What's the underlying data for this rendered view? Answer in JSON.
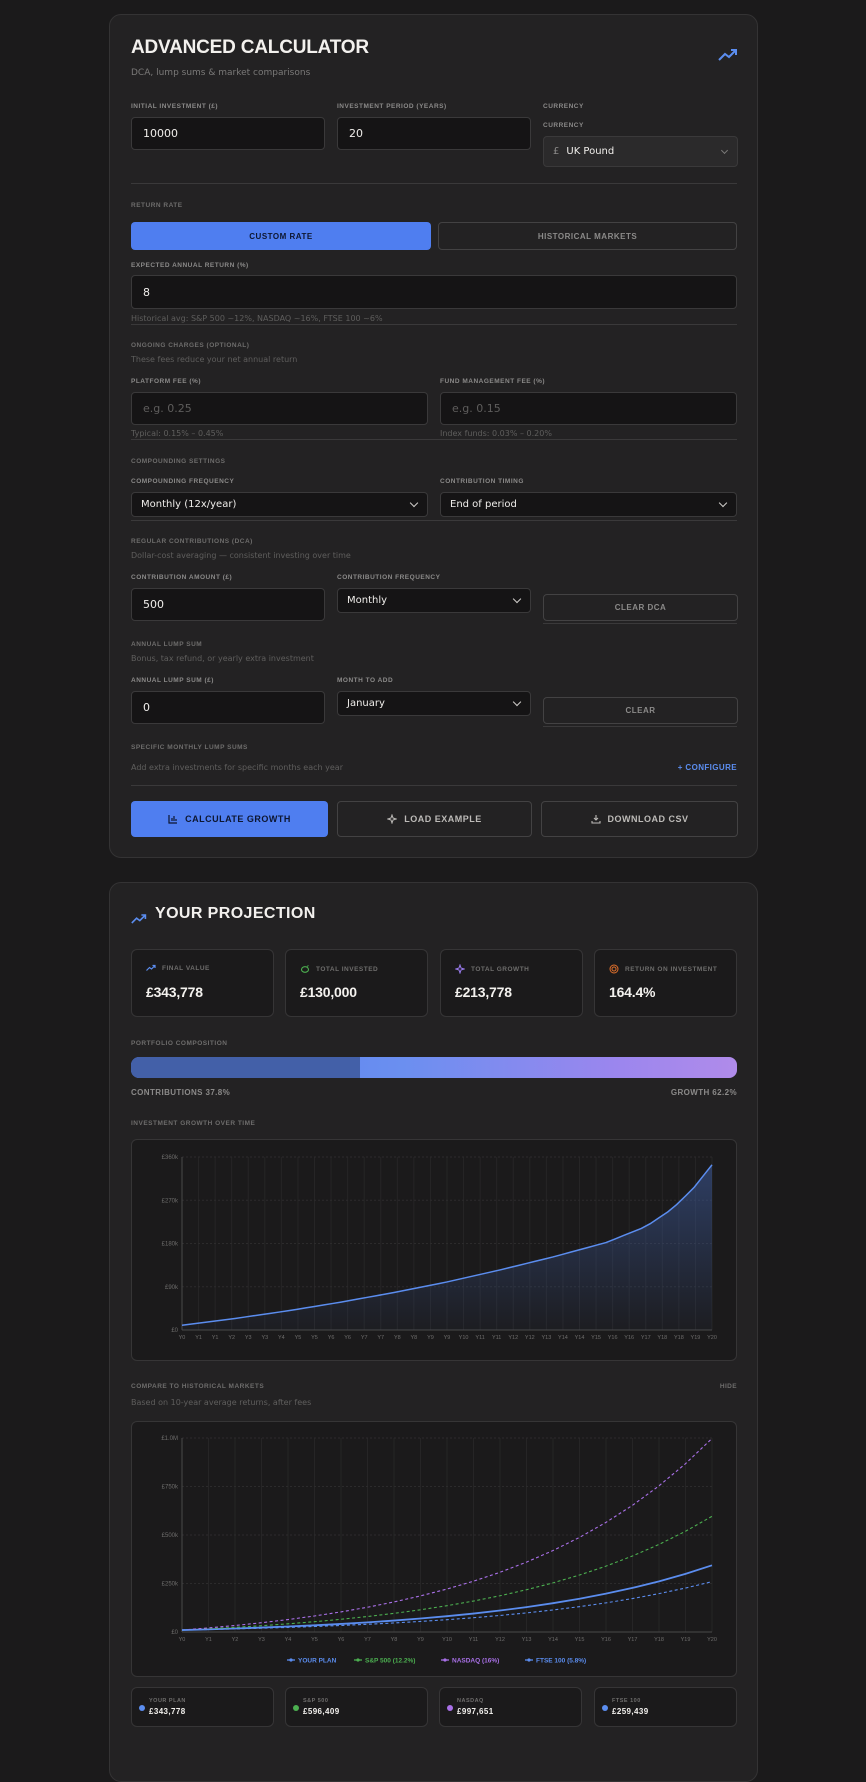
{
  "calc": {
    "title": "ADVANCED CALCULATOR",
    "subtitle": "DCA, lump sums & market comparisons",
    "initial_label": "INITIAL INVESTMENT (£)",
    "initial_value": "10000",
    "period_label": "INVESTMENT PERIOD (YEARS)",
    "period_value": "20",
    "currency_label": "CURRENCY",
    "currency_label2": "CURRENCY",
    "currency_symbol": "£",
    "currency_value": "UK  Pound",
    "return_rate_label": "RETURN RATE",
    "custom_rate": "CUSTOM RATE",
    "historical_markets": "HISTORICAL MARKETS",
    "expected_label": "EXPECTED ANNUAL RETURN (%)",
    "expected_value": "8",
    "expected_hint": "Historical avg: S&P 500 ~12%, NASDAQ ~16%, FTSE 100 ~6%",
    "charges_label": "ONGOING CHARGES (OPTIONAL)",
    "charges_hint": "These fees reduce your net annual return",
    "platform_fee_label": "PLATFORM FEE (%)",
    "platform_fee_placeholder": "e.g. 0.25",
    "platform_fee_hint": "Typical: 0.15% – 0.45%",
    "fund_fee_label": "FUND MANAGEMENT FEE (%)",
    "fund_fee_placeholder": "e.g. 0.15",
    "fund_fee_hint": "Index funds: 0.03% – 0.20%",
    "compounding_label": "COMPOUNDING SETTINGS",
    "comp_freq_label": "COMPOUNDING FREQUENCY",
    "comp_freq_value": "Monthly (12x/year)",
    "timing_label": "CONTRIBUTION TIMING",
    "timing_value": "End of period",
    "dca_label": "REGULAR CONTRIBUTIONS (DCA)",
    "dca_hint": "Dollar-cost averaging — consistent investing over time",
    "contrib_amount_label": "CONTRIBUTION AMOUNT (£)",
    "contrib_amount_value": "500",
    "contrib_freq_label": "CONTRIBUTION FREQUENCY",
    "contrib_freq_value": "Monthly",
    "clear_dca": "CLEAR DCA",
    "lump_label": "ANNUAL LUMP SUM",
    "lump_hint": "Bonus, tax refund, or yearly extra investment",
    "lump_amount_label": "ANNUAL LUMP SUM (£)",
    "lump_amount_value": "0",
    "month_label": "MONTH TO ADD",
    "month_value": "January",
    "clear": "CLEAR",
    "specific_label": "SPECIFIC MONTHLY LUMP SUMS",
    "specific_hint": "Add extra investments for specific months each year",
    "configure": "+ CONFIGURE",
    "calculate": "CALCULATE GROWTH",
    "load_example": "LOAD EXAMPLE",
    "download_csv": "DOWNLOAD CSV"
  },
  "projection": {
    "title": "YOUR PROJECTION",
    "stats": [
      {
        "label": "FINAL VALUE",
        "value": "£343,778",
        "icon": "trending-up-icon",
        "color": "#5b8def"
      },
      {
        "label": "TOTAL INVESTED",
        "value": "£130,000",
        "icon": "piggy-bank-icon",
        "color": "#4caf50"
      },
      {
        "label": "TOTAL GROWTH",
        "value": "£213,778",
        "icon": "sparkle-icon",
        "color": "#9b7cf0"
      },
      {
        "label": "RETURN ON INVESTMENT",
        "value": "164.4%",
        "icon": "target-icon",
        "color": "#e0702c"
      }
    ],
    "composition_label": "PORTFOLIO COMPOSITION",
    "contributions_text": "CONTRIBUTIONS 37.8%",
    "growth_text": "GROWTH 62.2%",
    "contributions_pct": 37.8,
    "growth_label": "INVESTMENT GROWTH OVER TIME",
    "compare_label": "COMPARE TO HISTORICAL MARKETS",
    "compare_hint": "Based on 10-year average returns, after fees",
    "hide": "HIDE",
    "mini_cards": [
      {
        "label": "YOUR PLAN",
        "value": "£343,778",
        "color": "#5b8def"
      },
      {
        "label": "S&P 500",
        "value": "£596,409",
        "color": "#4caf50"
      },
      {
        "label": "NASDAQ",
        "value": "£997,651",
        "color": "#a970e8"
      },
      {
        "label": "FTSE 100",
        "value": "£259,439",
        "color": "#5b8def"
      }
    ]
  },
  "chart_data": [
    {
      "type": "area",
      "title": "INVESTMENT GROWTH OVER TIME",
      "x": [
        "Y0",
        "Y1",
        "Y1",
        "Y2",
        "Y3",
        "Y3",
        "Y4",
        "Y5",
        "Y5",
        "Y6",
        "Y6",
        "Y7",
        "Y7",
        "Y8",
        "Y8",
        "Y9",
        "Y9",
        "Y10",
        "Y11",
        "Y11",
        "Y12",
        "Y12",
        "Y13",
        "Y14",
        "Y14",
        "Y15",
        "Y16",
        "Y16",
        "Y17",
        "Y18",
        "Y18",
        "Y19",
        "Y20"
      ],
      "ylim": [
        0,
        360000
      ],
      "yticks": [
        "£0",
        "£90k",
        "£180k",
        "£270k",
        "£360k"
      ],
      "series": [
        {
          "values": [
            10000,
            24000,
            40000,
            58000,
            78000,
            100000,
            125000,
            152000,
            182000,
            215000,
            252000,
            295000,
            343778
          ],
          "years": [
            0,
            2,
            4,
            6,
            8,
            10,
            12,
            14,
            16,
            17.5,
            18.5,
            19.3,
            20
          ]
        }
      ],
      "grid": true
    },
    {
      "type": "line",
      "title": "COMPARE TO HISTORICAL MARKETS",
      "x": [
        "Y0",
        "Y1",
        "Y2",
        "Y3",
        "Y4",
        "Y5",
        "Y6",
        "Y7",
        "Y8",
        "Y9",
        "Y10",
        "Y11",
        "Y12",
        "Y13",
        "Y14",
        "Y15",
        "Y16",
        "Y17",
        "Y18",
        "Y19",
        "Y20"
      ],
      "ylim": [
        0,
        1000000
      ],
      "yticks": [
        "£0",
        "£250k",
        "£500k",
        "£750k",
        "£1.0M"
      ],
      "legend_position": "bottom",
      "series": [
        {
          "name": "YOUR PLAN",
          "final": 343778,
          "color": "#5b8def",
          "dash": false
        },
        {
          "name": "S&P 500 (12.2%)",
          "final": 596409,
          "color": "#4caf50",
          "dash": true
        },
        {
          "name": "NASDAQ (16%)",
          "final": 997651,
          "color": "#a970e8",
          "dash": true
        },
        {
          "name": "FTSE 100 (5.8%)",
          "final": 259439,
          "color": "#5b8def",
          "dash": true
        }
      ],
      "grid": true
    }
  ]
}
